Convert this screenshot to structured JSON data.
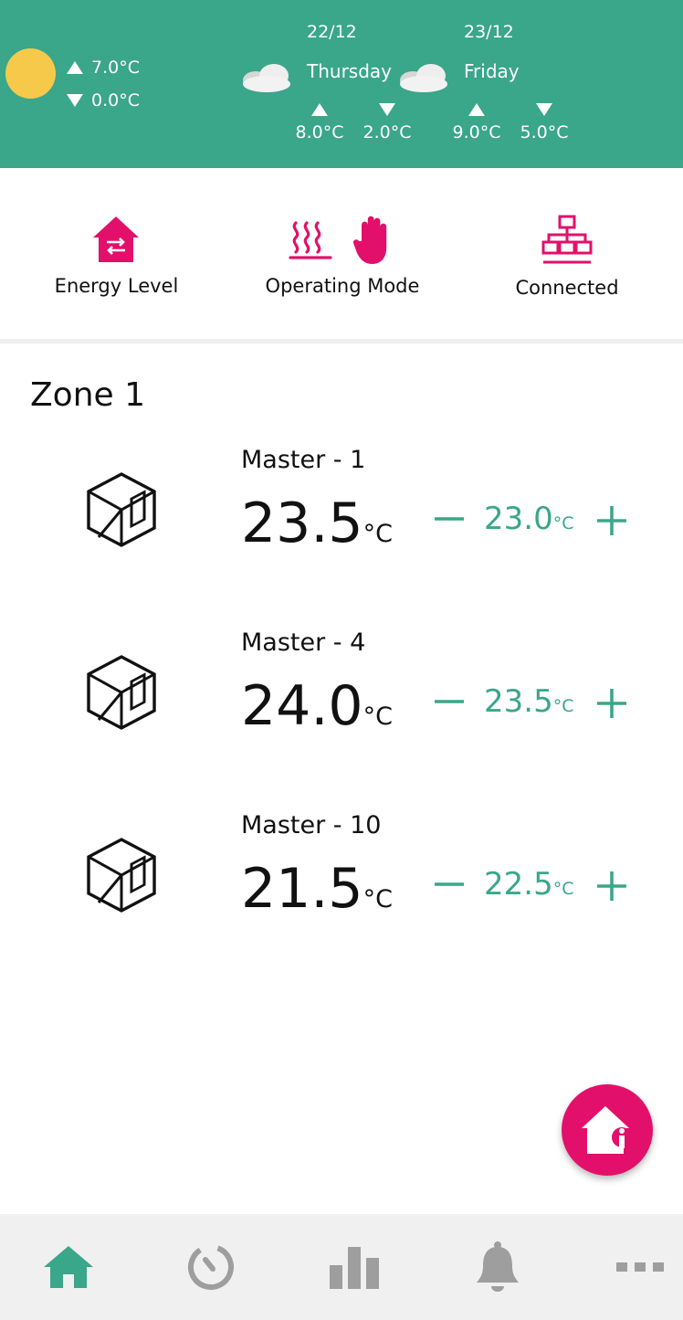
{
  "weather": {
    "today": {
      "high": "7.0°C",
      "low": "0.0°C",
      "icon": "sun-icon"
    },
    "forecast": [
      {
        "date": "22/12",
        "day": "Thursday",
        "high": "8.0°C",
        "low": "2.0°C",
        "icon": "cloud-icon"
      },
      {
        "date": "23/12",
        "day": "Friday",
        "high": "9.0°C",
        "low": "5.0°C",
        "icon": "cloud-icon"
      }
    ]
  },
  "status": {
    "energy": {
      "label": "Energy Level",
      "icon": "energy-house-icon"
    },
    "mode": {
      "label": "Operating Mode",
      "icons": [
        "heating-icon",
        "manual-hand-icon"
      ]
    },
    "connection": {
      "label": "Connected",
      "icon": "network-icon"
    }
  },
  "zone": {
    "title": "Zone 1",
    "rooms": [
      {
        "name": "Master - 1",
        "current": "23.5",
        "setpoint": "23.0",
        "unit": "°C"
      },
      {
        "name": "Master - 4",
        "current": "24.0",
        "setpoint": "23.5",
        "unit": "°C"
      },
      {
        "name": "Master - 10",
        "current": "21.5",
        "setpoint": "22.5",
        "unit": "°C"
      }
    ]
  },
  "fab": {
    "icon": "home-info-icon"
  },
  "nav": {
    "items": [
      "home-icon",
      "schedule-icon",
      "statistics-icon",
      "notifications-icon",
      "more-icon"
    ],
    "active": "home-icon"
  },
  "colors": {
    "brand_green": "#3aa68a",
    "accent_pink": "#e2106b",
    "sun": "#f7c94b",
    "nav_inactive": "#9e9e9e"
  }
}
